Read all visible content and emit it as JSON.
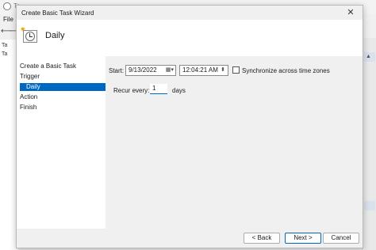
{
  "background_window": {
    "title": "Ta",
    "menu_file": "File",
    "arrows": [
      "⟵",
      "⟶"
    ],
    "tree_rows": [
      "Ta",
      "Ta"
    ]
  },
  "dialog": {
    "title": "Create Basic Task Wizard",
    "close_glyph": "✕",
    "header_title": "Daily"
  },
  "nav": {
    "items": [
      "Create a Basic Task",
      "Trigger",
      "Daily",
      "Action",
      "Finish"
    ],
    "selected_index": 2
  },
  "form": {
    "start_label": "Start:",
    "date_value": "9/13/2022",
    "time_value": "12:04:21 AM",
    "sync_label": "Synchronize across time zones",
    "sync_checked": false,
    "recur_label": "Recur every:",
    "recur_value": "1",
    "recur_unit": "days"
  },
  "footer": {
    "back_label": "< Back",
    "next_label": "Next >",
    "cancel_label": "Cancel"
  },
  "colors": {
    "accent": "#0067c0",
    "dialog_bg": "#f0f0f0",
    "header_bg": "#ffffff"
  }
}
